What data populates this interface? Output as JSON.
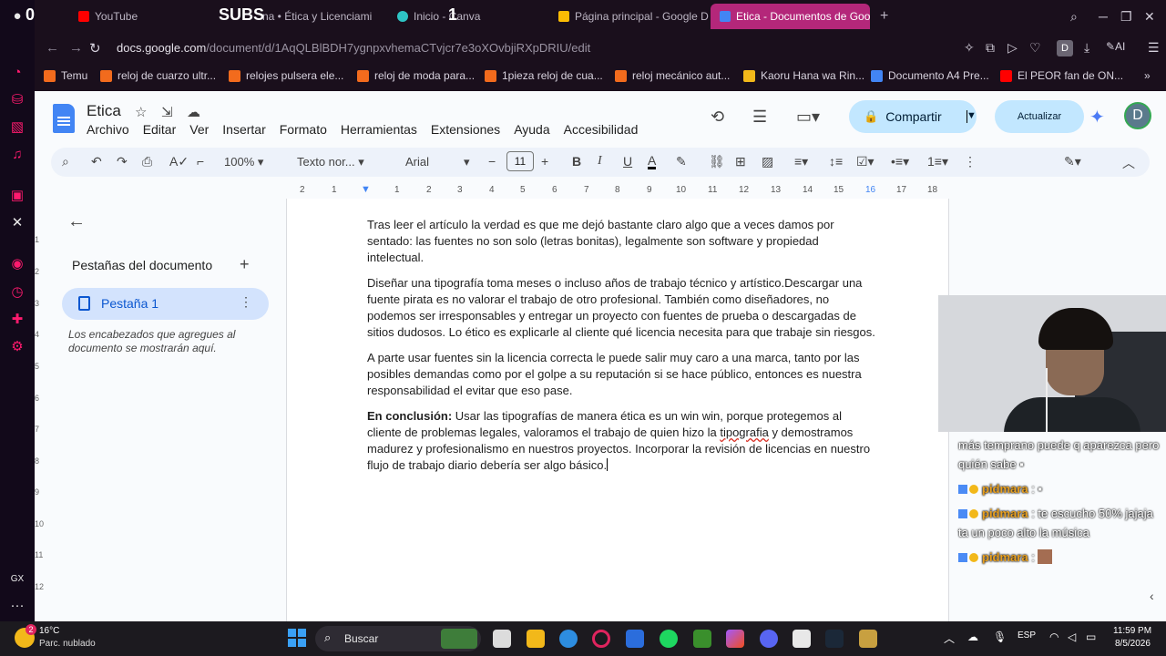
{
  "tabs": [
    {
      "label": "YouTube",
      "favicon_color": "#ff0000"
    },
    {
      "label": "na • Ética y Licenciami",
      "favicon_color": "#7a6b84"
    },
    {
      "label": "Inicio - Canva",
      "favicon_color": "#2ec4c4"
    },
    {
      "label": "Página principal - Google D",
      "favicon_color": "#fbbc04"
    },
    {
      "label": "Etica - Documentos de Goo",
      "favicon_color": "#4285f4"
    }
  ],
  "overlay": {
    "left_count": "0",
    "subs_label": "SUBS",
    "subs_count": "1"
  },
  "address": {
    "host": "docs.google.com",
    "path": "/document/d/1AqQLBlBDH7ygnpxvhemaCTvjcr7e3oXOvbjiRXpDRIU/edit"
  },
  "bookmarks": [
    {
      "label": "Temu",
      "color": "#f26b1d"
    },
    {
      "label": "reloj de cuarzo ultr...",
      "color": "#f26b1d"
    },
    {
      "label": "relojes pulsera ele...",
      "color": "#f26b1d"
    },
    {
      "label": "reloj de moda para...",
      "color": "#f26b1d"
    },
    {
      "label": "1pieza reloj de cua...",
      "color": "#f26b1d"
    },
    {
      "label": "reloj mecánico aut...",
      "color": "#f26b1d"
    },
    {
      "label": "Kaoru Hana wa Rin...",
      "color": "#f2b81a"
    },
    {
      "label": "Documento A4 Pre...",
      "color": "#4285f4"
    },
    {
      "label": "El PEOR fan de ON...",
      "color": "#ff0000"
    }
  ],
  "docs": {
    "title": "Etica",
    "menu": [
      "Archivo",
      "Editar",
      "Ver",
      "Insertar",
      "Formato",
      "Herramientas",
      "Extensiones",
      "Ayuda",
      "Accesibilidad"
    ],
    "share_label": "Compartir",
    "update_label": "Actualizar",
    "avatar_letter": "D"
  },
  "toolbar": {
    "zoom": "100%",
    "style": "Texto nor...",
    "font": "Arial",
    "font_size": "11"
  },
  "ruler": {
    "numbers": [
      "2",
      "1",
      "1",
      "2",
      "3",
      "4",
      "5",
      "6",
      "7",
      "8",
      "9",
      "10",
      "11",
      "12",
      "13",
      "14",
      "15",
      "16",
      "17",
      "18"
    ]
  },
  "vruler": {
    "numbers": [
      "1",
      "2",
      "3",
      "4",
      "5",
      "6",
      "7",
      "8",
      "9",
      "10",
      "11",
      "12"
    ]
  },
  "sidebar": {
    "heading": "Pestañas del documento",
    "tab_label": "Pestaña 1",
    "hint": "Los encabezados que agregues al documento se mostrarán aquí."
  },
  "document": {
    "p1": "Tras leer el artículo la verdad es que me dejó bastante claro algo que a veces damos por sentado: las fuentes no son solo (letras bonitas), legalmente son software y propiedad intelectual.",
    "p2": "Diseñar una tipografía toma meses o incluso años de trabajo técnico y artístico.Descargar una fuente pirata es no valorar el trabajo de otro profesional. También como diseñadores, no podemos ser irresponsables y entregar un proyecto con fuentes de prueba o descargadas de sitios dudosos. Lo ético es explicarle al cliente qué licencia necesita para que trabaje sin riesgos.",
    "p3": "A parte usar fuentes sin la licencia correcta le puede salir muy caro a una marca, tanto por las posibles demandas como por el golpe a su reputación si se hace público, entonces es nuestra responsabilidad el evitar que eso  pase.",
    "p4_bold": "En conclusión:",
    "p4_a": " Usar las tipografías de manera ética es un win win, porque protegemos al cliente de problemas legales, valoramos el trabajo de quien hizo la ",
    "p4_spell": "tipografia",
    "p4_b": " y demostramos madurez y profesionalismo en nuestros proyectos. Incorporar la revisión de licencias en nuestro flujo de trabajo diario debería ser algo básico."
  },
  "chat": [
    {
      "user": "pidmara",
      "text": "más temprano puede q aparezca pero quién sabe"
    },
    {
      "user": "pidmara",
      "text": ""
    },
    {
      "user": "pidmara",
      "text": "te escucho 50% jajaja ta un poco alto la música"
    },
    {
      "user": "pidmara",
      "text": ""
    }
  ],
  "taskbar": {
    "temp": "16°C",
    "weather": "Parc. nublado",
    "weather_badge": "2",
    "search_label": "Buscar",
    "lang": "ESP",
    "time": "11:59 PM",
    "date": "8/5/2026"
  }
}
